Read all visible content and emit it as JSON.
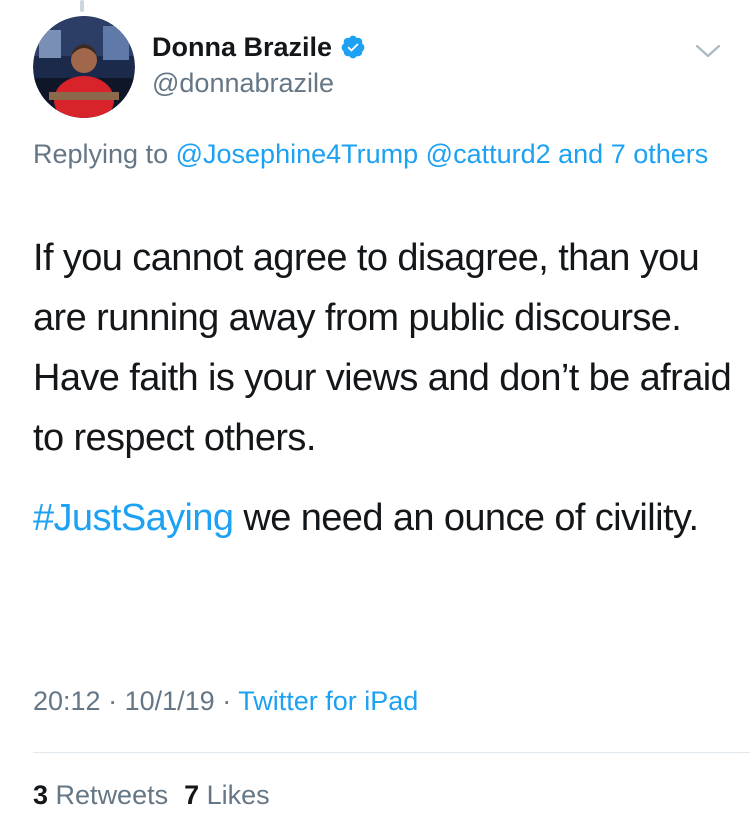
{
  "tweet": {
    "author": {
      "display_name": "Donna Brazile",
      "handle": "@donnabrazile",
      "verified": true,
      "avatar_icon": "profile-photo"
    },
    "replying": {
      "prefix": "Replying to",
      "mentions": [
        "@Josephine4Trump",
        "@catturd2"
      ],
      "others": "and 7 others"
    },
    "text": {
      "paragraph1": "If you cannot agree to disagree, than you are running away from public discourse. Have faith is your views and don’t be afraid to respect others.",
      "hashtag": "#JustSaying",
      "paragraph2_rest": "we need an ounce of civility."
    },
    "meta": {
      "time": "20:12",
      "date": "10/1/19",
      "separator": "·",
      "source": "Twitter for iPad"
    },
    "stats": {
      "retweets_count": "3",
      "retweets_label": "Retweets",
      "likes_count": "7",
      "likes_label": "Likes"
    }
  },
  "colors": {
    "link": "#1da1f2",
    "secondary_text": "#657786",
    "primary_text": "#14171a",
    "divider": "#e1e8ed",
    "verified_badge": "#1da1f2"
  },
  "icons": {
    "verified": "verified-badge-icon",
    "caret": "chevron-down-icon"
  }
}
